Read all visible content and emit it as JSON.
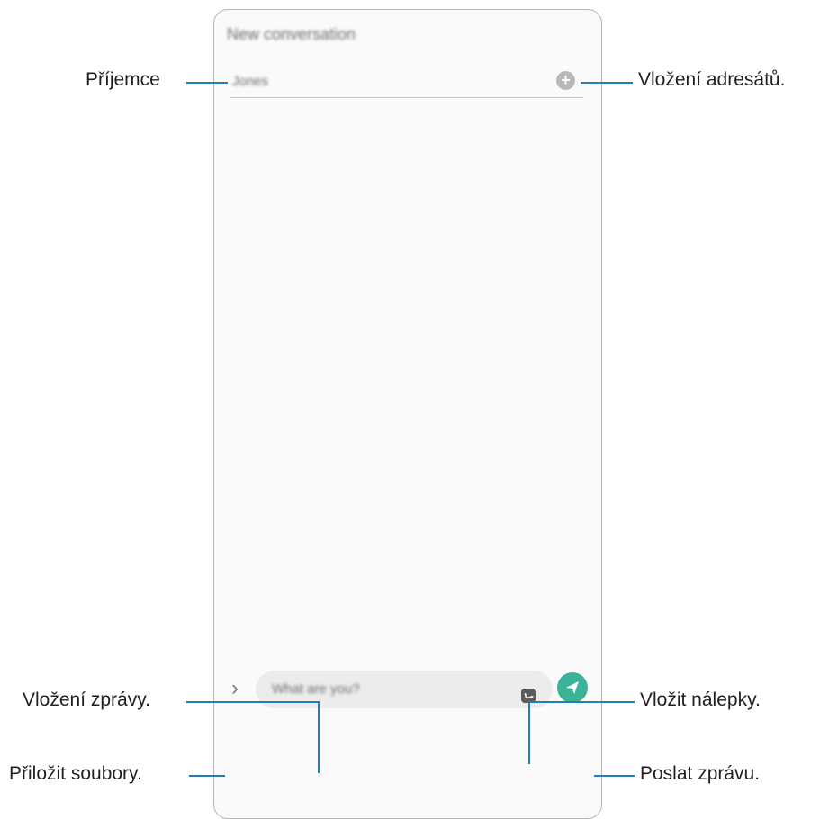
{
  "phone": {
    "title": "New conversation",
    "recipient_placeholder": "Jones",
    "message_placeholder": "What are you?"
  },
  "callouts": {
    "recipient": "Příjemce",
    "add_recipients": "Vložení adresátů.",
    "enter_message": "Vložení zprávy.",
    "stickers": "Vložit nálepky.",
    "attach": "Přiložit soubory.",
    "send": "Poslat zprávu."
  },
  "colors": {
    "accent": "#1f7fb6",
    "send": "#3bb39a"
  },
  "icons": [
    "add-icon",
    "chevron-right-icon",
    "sticker-icon",
    "send-icon"
  ]
}
